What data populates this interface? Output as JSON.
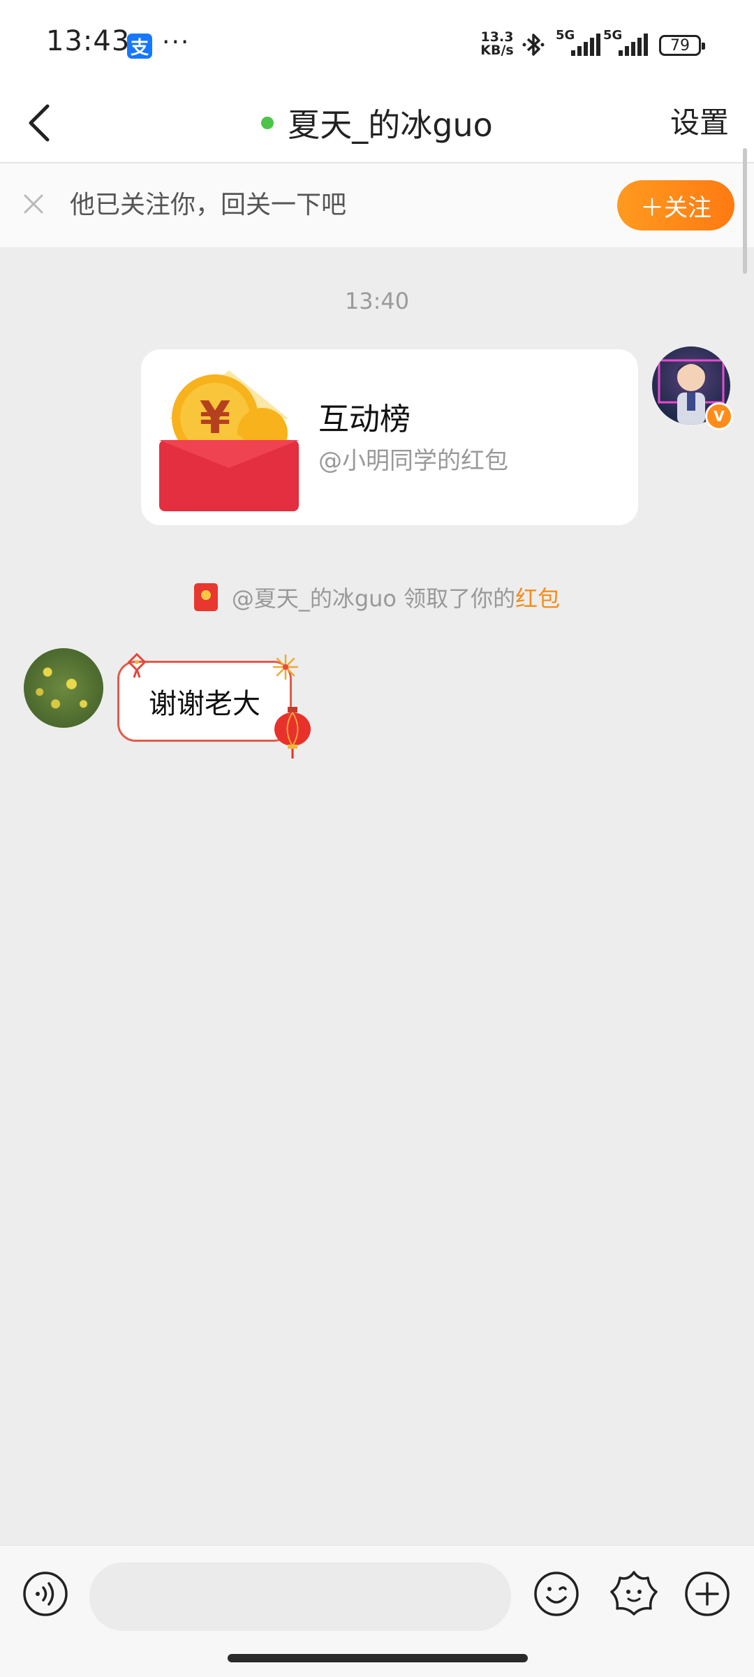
{
  "status_bar": {
    "time": "13:43",
    "app_badge": "支",
    "more": "···",
    "net_speed_value": "13.3",
    "net_speed_unit": "KB/s",
    "sim1": "5G",
    "sim2": "5G",
    "battery": "79"
  },
  "nav": {
    "title": "夏天_的冰guo",
    "settings": "设置",
    "online_color": "#4cc44a"
  },
  "follow_banner": {
    "text": "他已关注你，回关一下吧",
    "button": "＋关注"
  },
  "chat": {
    "timestamp": "13:40",
    "red_packet": {
      "title": "互动榜",
      "subtitle": "@小明同学的红包"
    },
    "notice": {
      "prefix": "@夏天_的冰guo 领取了你的",
      "link": "红包"
    },
    "incoming_message": "谢谢老大"
  },
  "input_bar": {
    "placeholder": "",
    "icons": [
      "voice-icon",
      "emoji-icon",
      "sticker-icon",
      "plus-icon"
    ]
  },
  "colors": {
    "accent": "#ff8c1a",
    "link": "#f28d1b",
    "background": "#ededed"
  }
}
